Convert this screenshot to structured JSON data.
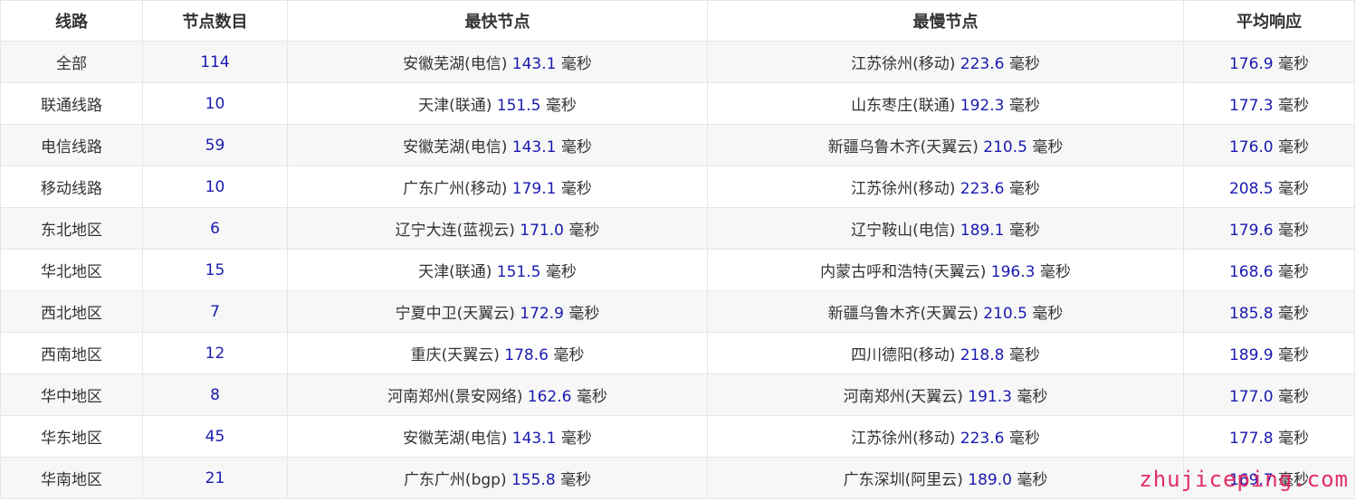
{
  "table": {
    "headers": [
      "线路",
      "节点数目",
      "最快节点",
      "最慢节点",
      "平均响应"
    ],
    "unit": "毫秒",
    "rows": [
      {
        "line": "全部",
        "count": "114",
        "fastest_loc": "安徽芜湖(电信)",
        "fastest_ms": "143.1",
        "slowest_loc": "江苏徐州(移动)",
        "slowest_ms": "223.6",
        "avg_ms": "176.9"
      },
      {
        "line": "联通线路",
        "count": "10",
        "fastest_loc": "天津(联通)",
        "fastest_ms": "151.5",
        "slowest_loc": "山东枣庄(联通)",
        "slowest_ms": "192.3",
        "avg_ms": "177.3"
      },
      {
        "line": "电信线路",
        "count": "59",
        "fastest_loc": "安徽芜湖(电信)",
        "fastest_ms": "143.1",
        "slowest_loc": "新疆乌鲁木齐(天翼云)",
        "slowest_ms": "210.5",
        "avg_ms": "176.0"
      },
      {
        "line": "移动线路",
        "count": "10",
        "fastest_loc": "广东广州(移动)",
        "fastest_ms": "179.1",
        "slowest_loc": "江苏徐州(移动)",
        "slowest_ms": "223.6",
        "avg_ms": "208.5"
      },
      {
        "line": "东北地区",
        "count": "6",
        "fastest_loc": "辽宁大连(蓝视云)",
        "fastest_ms": "171.0",
        "slowest_loc": "辽宁鞍山(电信)",
        "slowest_ms": "189.1",
        "avg_ms": "179.6"
      },
      {
        "line": "华北地区",
        "count": "15",
        "fastest_loc": "天津(联通)",
        "fastest_ms": "151.5",
        "slowest_loc": "内蒙古呼和浩特(天翼云)",
        "slowest_ms": "196.3",
        "avg_ms": "168.6"
      },
      {
        "line": "西北地区",
        "count": "7",
        "fastest_loc": "宁夏中卫(天翼云)",
        "fastest_ms": "172.9",
        "slowest_loc": "新疆乌鲁木齐(天翼云)",
        "slowest_ms": "210.5",
        "avg_ms": "185.8"
      },
      {
        "line": "西南地区",
        "count": "12",
        "fastest_loc": "重庆(天翼云)",
        "fastest_ms": "178.6",
        "slowest_loc": "四川德阳(移动)",
        "slowest_ms": "218.8",
        "avg_ms": "189.9"
      },
      {
        "line": "华中地区",
        "count": "8",
        "fastest_loc": "河南郑州(景安网络)",
        "fastest_ms": "162.6",
        "slowest_loc": "河南郑州(天翼云)",
        "slowest_ms": "191.3",
        "avg_ms": "177.0"
      },
      {
        "line": "华东地区",
        "count": "45",
        "fastest_loc": "安徽芜湖(电信)",
        "fastest_ms": "143.1",
        "slowest_loc": "江苏徐州(移动)",
        "slowest_ms": "223.6",
        "avg_ms": "177.8"
      },
      {
        "line": "华南地区",
        "count": "21",
        "fastest_loc": "广东广州(bgp)",
        "fastest_ms": "155.8",
        "slowest_loc": "广东深圳(阿里云)",
        "slowest_ms": "189.0",
        "avg_ms": "169.7"
      }
    ]
  },
  "watermark": {
    "text": "zhujiceping.com",
    "color": "#e0245e"
  },
  "colors": {
    "number_blue": "#1a1ab0",
    "text_dark": "#333333",
    "stripe": "#f7f7f7",
    "border": "#e6e6e6"
  }
}
